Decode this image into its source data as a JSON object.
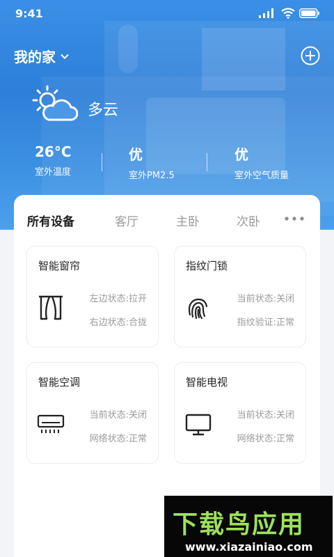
{
  "status_bar": {
    "time": "9:41"
  },
  "header": {
    "home_name": "我的家"
  },
  "weather": {
    "condition": "多云",
    "metrics": [
      {
        "value": "26°C",
        "label": "室外温度"
      },
      {
        "value": "优",
        "label": "室外PM2.5"
      },
      {
        "value": "优",
        "label": "室外空气质量"
      }
    ]
  },
  "tabs": [
    {
      "label": "所有设备",
      "active": true
    },
    {
      "label": "客厅",
      "active": false
    },
    {
      "label": "主卧",
      "active": false
    },
    {
      "label": "次卧",
      "active": false
    }
  ],
  "devices": [
    {
      "name": "智能窗帘",
      "icon": "curtain-icon",
      "status_1": "左边状态:拉开",
      "status_2": "右边状态:合拢"
    },
    {
      "name": "指纹门锁",
      "icon": "fingerprint-icon",
      "status_1": "当前状态:关闭",
      "status_2": "指纹验证:正常"
    },
    {
      "name": "智能空调",
      "icon": "air-conditioner-icon",
      "status_1": "当前状态:关闭",
      "status_2": "网络状态:正常"
    },
    {
      "name": "智能电视",
      "icon": "tv-icon",
      "status_1": "当前状态:关闭",
      "status_2": "网络状态:正常"
    }
  ],
  "watermark": {
    "brand": "下载鸟应用",
    "url": "www.xiazainiao.com"
  },
  "colors": {
    "header_blue": "#3a8fe6",
    "accent_green": "#9ce25a"
  }
}
